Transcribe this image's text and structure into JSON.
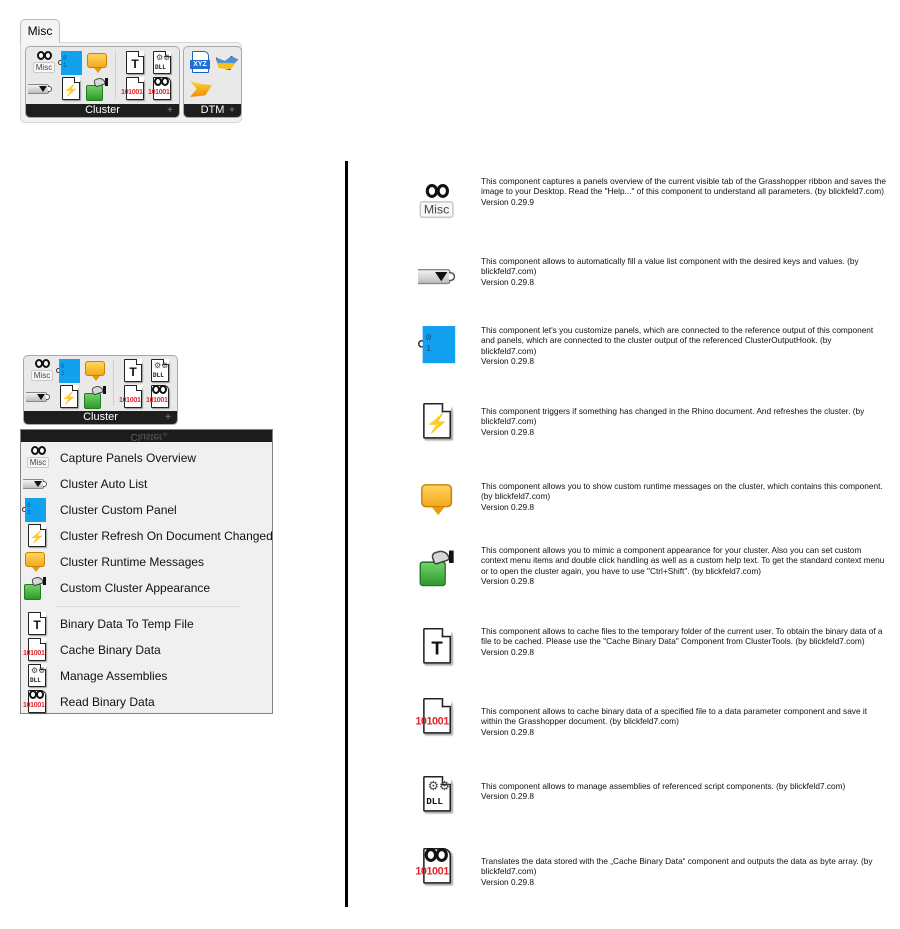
{
  "ribbon": {
    "tab_label": "Misc",
    "panels": [
      {
        "name": "Cluster",
        "expand_icon": "+"
      },
      {
        "name": "DTM",
        "expand_icon": "+"
      }
    ],
    "misc_tag": "Misc"
  },
  "menu": {
    "header_label": "Cluster",
    "header_plus": "+",
    "items": [
      {
        "label": "Capture Panels Overview",
        "icon": "misc-eyes-icon"
      },
      {
        "label": "Cluster Auto List",
        "icon": "value-list-icon"
      },
      {
        "label": "Cluster Custom Panel",
        "icon": "blue-panel-icon"
      },
      {
        "label": "Cluster Refresh On Document Changed",
        "icon": "lightning-document-icon"
      },
      {
        "label": "Cluster Runtime Messages",
        "icon": "speech-bubble-icon"
      },
      {
        "label": "Custom Cluster Appearance",
        "icon": "green-box-hand-icon"
      },
      {
        "label": "Binary Data To Temp File",
        "icon": "text-document-icon"
      },
      {
        "label": "Cache Binary Data",
        "icon": "binary-document-icon"
      },
      {
        "label": "Manage Assemblies",
        "icon": "dll-document-icon"
      },
      {
        "label": "Read Binary Data",
        "icon": "binary-eyes-document-icon"
      }
    ]
  },
  "descriptions": [
    {
      "text": "This component captures a panels overview of the current visible tab of the Grasshopper ribbon and saves the image to your Desktop. Read the \"Help...\" of this component to understand all parameters. (by blickfeld7.com)",
      "version": "Version 0.29.9"
    },
    {
      "text": "This component allows to automatically fill a value list component with the desired keys and values. (by blickfeld7.com)",
      "version": "Version 0.29.8"
    },
    {
      "text": "This component let's you customize panels, which are connected to the reference output of this component and panels, which are connected to the cluster output of the referenced ClusterOutputHook. (by blickfeld7.com)",
      "version": "Version 0.29.8"
    },
    {
      "text": "This component triggers if something has changed in the Rhino document. And refreshes the cluster. (by blickfeld7.com)",
      "version": "Version 0.29.8"
    },
    {
      "text": "This component allows you to show custom runtime messages on the cluster, which contains this component. (by blickfeld7.com)",
      "version": "Version 0.29.8"
    },
    {
      "text": "This component allows you to mimic a component appearance for your cluster. Also you can set custom context menu items and double click handling as well as a custom help text. To get the standard context menu or to open the cluster again, you have to use \"Ctrl+Shift\". (by blickfeld7.com)",
      "version": "Version 0.29.8"
    },
    {
      "text": "This component allows to cache files to the temporary folder of the current user. To obtain the binary data of a file to be cached. Please use the \"Cache Binary Data\" Component from ClusterTools. (by blickfeld7.com)",
      "version": "Version 0.29.8"
    },
    {
      "text": "This component allows to cache binary data of a specified file to a data parameter component and save it within the Grasshopper document. (by blickfeld7.com)",
      "version": "Version 0.29.8"
    },
    {
      "text": "This component allows to manage assemblies of referenced script components. (by blickfeld7.com)",
      "version": "Version 0.29.8"
    },
    {
      "text": "Translates the data stored with the „Cache Binary Data“ component and outputs the data as byte array. (by blickfeld7.com)",
      "version": "Version 0.29.8"
    }
  ],
  "icon_glyphs": {
    "text_T": "T",
    "bits": "101001",
    "dll": "DLL",
    "gears": "⚙⚙",
    "bolt": "⚡",
    "xyz": "XYZ"
  }
}
